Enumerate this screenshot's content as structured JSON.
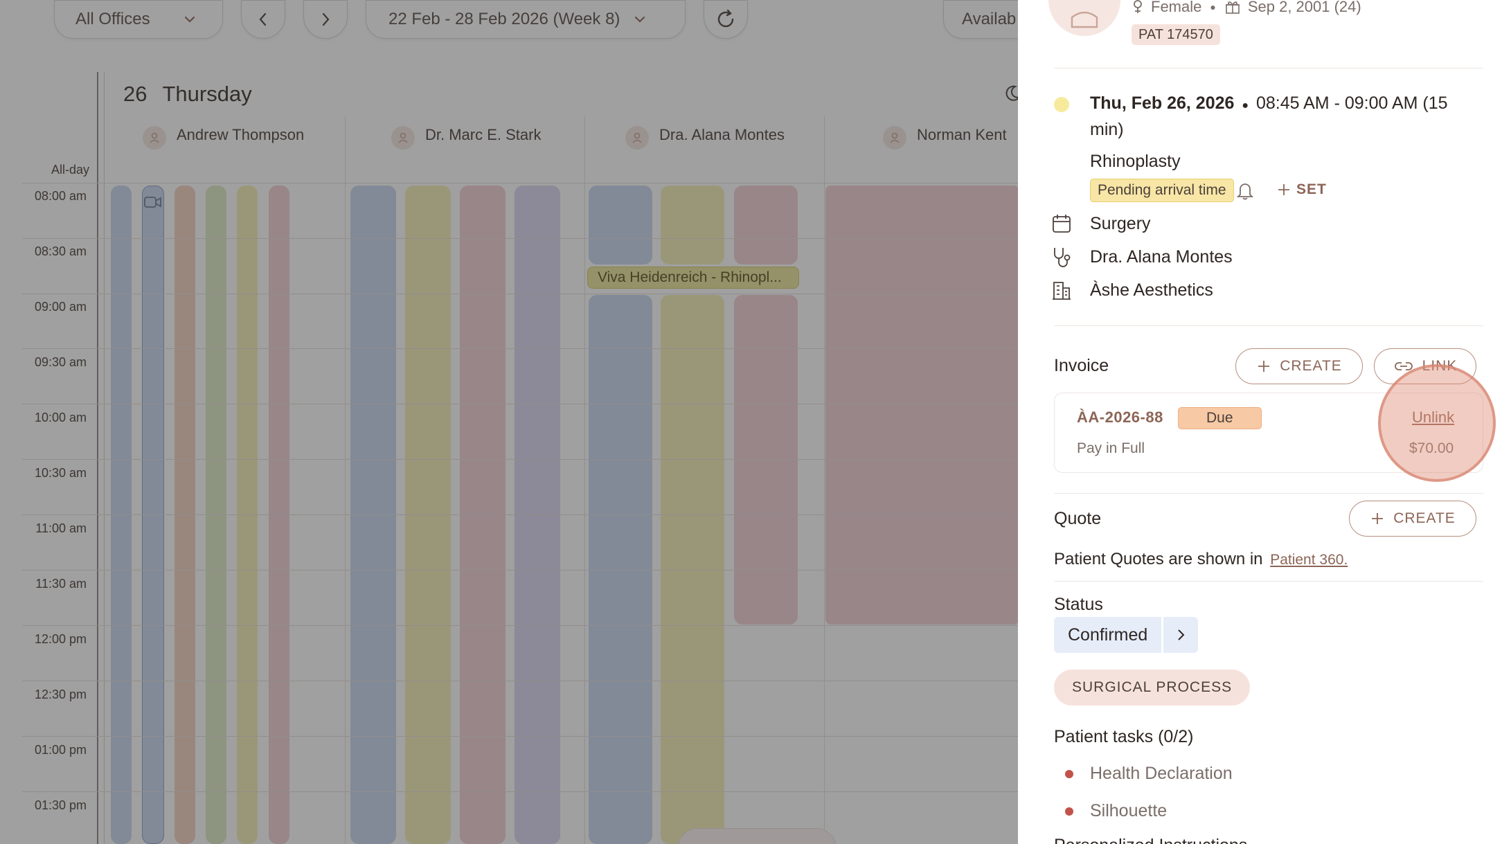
{
  "toolbar": {
    "office_select": "All Offices",
    "week_range": "22 Feb - 28 Feb 2026 (Week 8)",
    "availability": "Availab"
  },
  "calendar": {
    "day_number": "26",
    "day_name": "Thursday",
    "all_day_label": "All-day",
    "providers": [
      "Andrew Thompson",
      "Dr. Marc E. Stark",
      "Dra. Alana Montes",
      "Norman Kent"
    ],
    "times": [
      "08:00 am",
      "08:30 am",
      "09:00 am",
      "09:30 am",
      "10:00 am",
      "10:30 am",
      "11:00 am",
      "11:30 am",
      "12:00 pm",
      "12:30 pm",
      "01:00 pm",
      "01:30 pm"
    ],
    "appointment_label": "Viva Heidenreich - Rhinopl..."
  },
  "panel": {
    "patient": {
      "gender": "Female",
      "birthdate": "Sep 2, 2001 (24)",
      "id_badge": "PAT 174570"
    },
    "appointment": {
      "date": "Thu, Feb 26, 2026",
      "time_line1": "08:45 AM - 09:00 AM (15",
      "time_line2": "min)",
      "procedure": "Rhinoplasty",
      "arrival_badge": "Pending arrival time",
      "set_label": "SET",
      "category": "Surgery",
      "doctor": "Dra. Alana Montes",
      "clinic": "Àshe Aesthetics"
    },
    "invoice": {
      "heading": "Invoice",
      "create_label": "CREATE",
      "link_label": "LINK",
      "number": "ÀA-2026-88",
      "status": "Due",
      "plan": "Pay in Full",
      "unlink_label": "Unlink",
      "amount": "$70.00"
    },
    "quote": {
      "heading": "Quote",
      "create_label": "CREATE",
      "note": "Patient Quotes are shown in",
      "link": "Patient 360."
    },
    "status": {
      "heading": "Status",
      "value": "Confirmed"
    },
    "process_chip": "SURGICAL PROCESS",
    "tasks": {
      "heading": "Patient tasks (0/2)",
      "items": [
        "Health Declaration",
        "Silhouette"
      ]
    },
    "next_heading": "Personalized Instructions"
  },
  "colors": {
    "accent": "#8c6556",
    "due_badge": "#f7c9a5",
    "arrival_badge": "#f8e6a6",
    "status_bg": "#e6edf9",
    "task_dot": "#c2524a"
  }
}
